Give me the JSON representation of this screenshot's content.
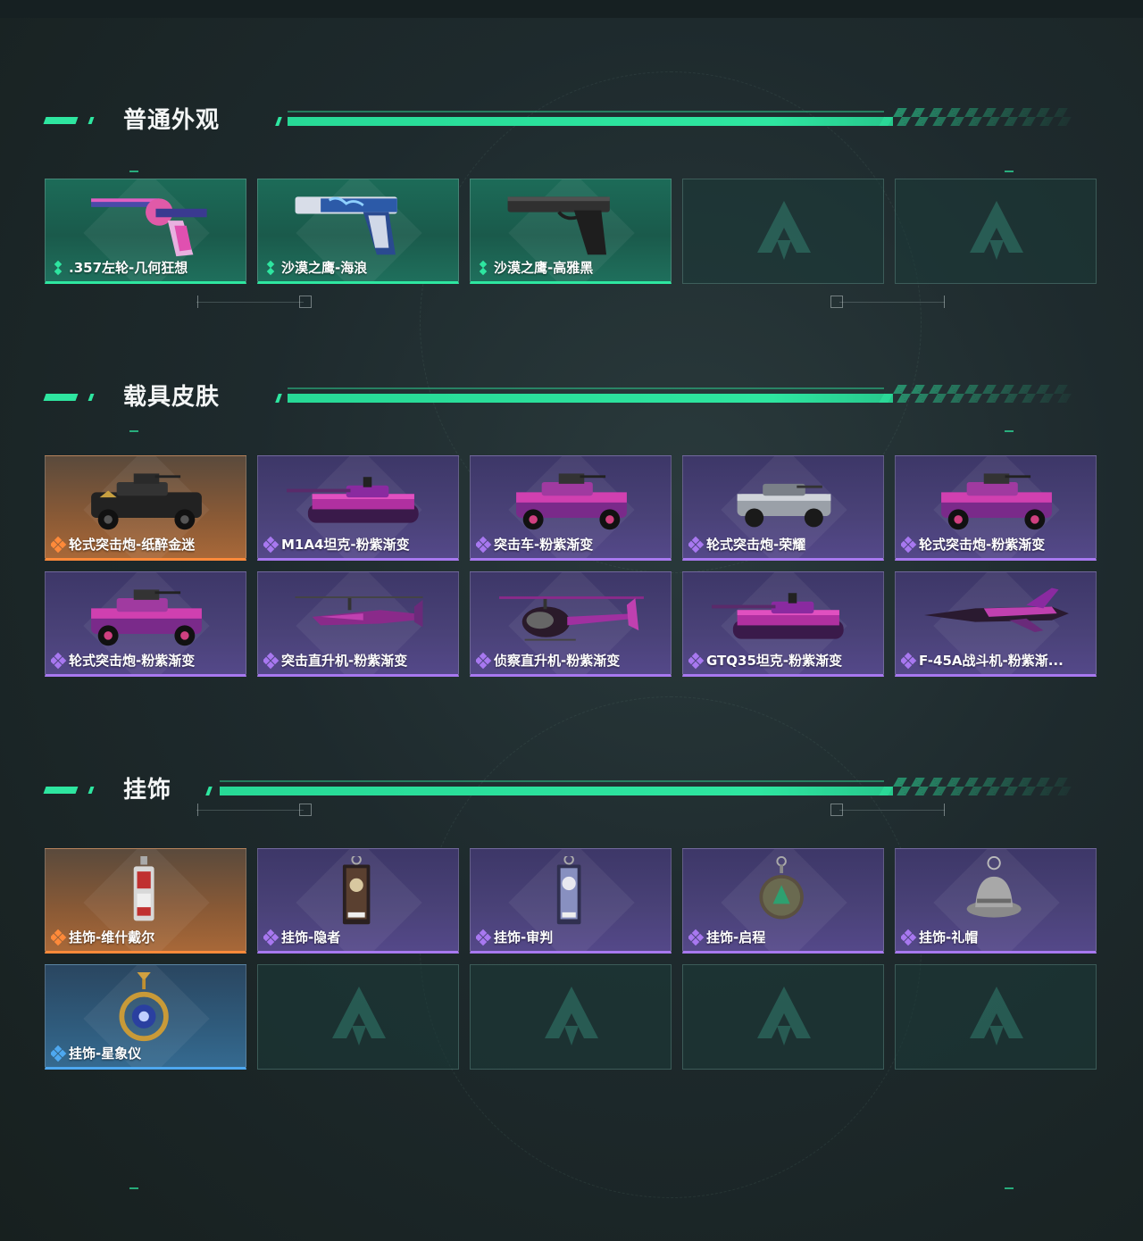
{
  "sections": [
    {
      "title": "普通外观",
      "items": [
        {
          "name": ".357左轮-几何狂想",
          "rarity": "green",
          "art": "revolver"
        },
        {
          "name": "沙漠之鹰-海浪",
          "rarity": "green",
          "art": "pistol-blue"
        },
        {
          "name": "沙漠之鹰-高雅黑",
          "rarity": "green",
          "art": "pistol-black"
        },
        {
          "name": "",
          "rarity": "empty"
        },
        {
          "name": "",
          "rarity": "empty"
        }
      ]
    },
    {
      "title": "载具皮肤",
      "items": [
        {
          "name": "轮式突击炮-纸醉金迷",
          "rarity": "orange",
          "art": "armored-car-black"
        },
        {
          "name": "M1A4坦克-粉紫渐变",
          "rarity": "purple",
          "art": "tank"
        },
        {
          "name": "突击车-粉紫渐变",
          "rarity": "purple",
          "art": "armored-car"
        },
        {
          "name": "轮式突击炮-荣耀",
          "rarity": "purple",
          "art": "armored-car-white"
        },
        {
          "name": "轮式突击炮-粉紫渐变",
          "rarity": "purple",
          "art": "armored-car"
        },
        {
          "name": "轮式突击炮-粉紫渐变",
          "rarity": "purple",
          "art": "armored-car"
        },
        {
          "name": "突击直升机-粉紫渐变",
          "rarity": "purple",
          "art": "attack-heli"
        },
        {
          "name": "侦察直升机-粉紫渐变",
          "rarity": "purple",
          "art": "scout-heli"
        },
        {
          "name": "GTQ35坦克-粉紫渐变",
          "rarity": "purple",
          "art": "tank"
        },
        {
          "name": "F-45A战斗机-粉紫渐...",
          "rarity": "purple",
          "art": "jet"
        }
      ]
    },
    {
      "title": "挂饰",
      "items": [
        {
          "name": "挂饰-维什戴尔",
          "rarity": "orange",
          "art": "charm-tag"
        },
        {
          "name": "挂饰-隐者",
          "rarity": "purple",
          "art": "charm-card"
        },
        {
          "name": "挂饰-审判",
          "rarity": "purple",
          "art": "charm-card-light"
        },
        {
          "name": "挂饰-启程",
          "rarity": "purple",
          "art": "charm-medal"
        },
        {
          "name": "挂饰-礼帽",
          "rarity": "purple",
          "art": "charm-hat"
        },
        {
          "name": "挂饰-星象仪",
          "rarity": "blue",
          "art": "charm-astrolabe"
        },
        {
          "name": "",
          "rarity": "empty"
        },
        {
          "name": "",
          "rarity": "empty"
        },
        {
          "name": "",
          "rarity": "empty"
        },
        {
          "name": "",
          "rarity": "empty"
        }
      ]
    }
  ],
  "colors": {
    "accent": "#2ee6a0",
    "green": "#2ee6a0",
    "purple": "#a878f0",
    "orange": "#ff8a3a",
    "blue": "#4ea8f0",
    "background": "#1e2a2d"
  }
}
